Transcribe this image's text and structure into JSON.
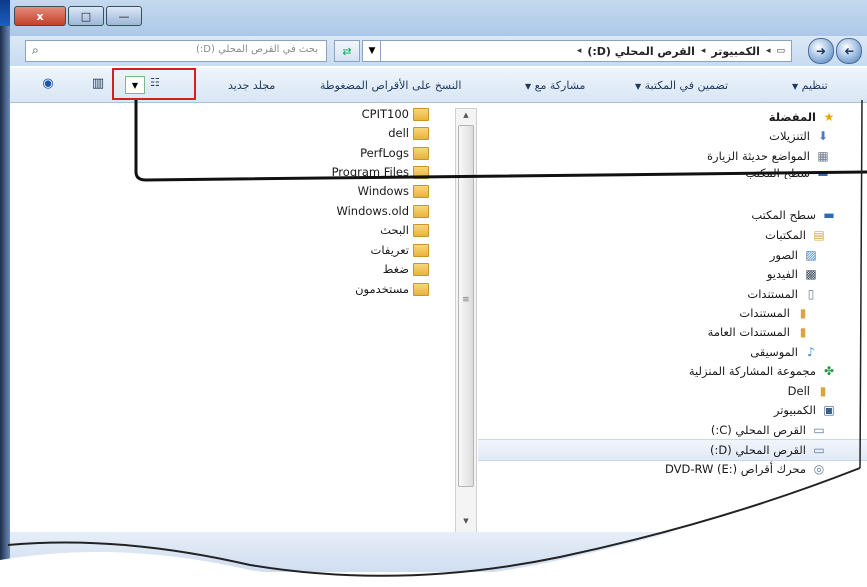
{
  "window": {
    "caption_buttons": [
      "x",
      "□",
      "—"
    ]
  },
  "address": {
    "search_placeholder": "بحث في القرص المحلي (D:)",
    "crumbs": [
      "الكمبيوتر",
      "القرص المحلي (D:)"
    ]
  },
  "toolbar": {
    "organize": "تنظيم",
    "include_library": "تضمين في المكتبة",
    "share_with": "مشاركة مع",
    "burn": "النسخ على الأقراص المضغوطة",
    "new_folder": "مجلد جديد"
  },
  "nav_tree": [
    {
      "label": "المفضلة",
      "icon": "star-icon",
      "bold": true
    },
    {
      "label": "التنزيلات",
      "icon": "downloads-icon",
      "bold": false
    },
    {
      "label": "المواضع حديثة الزيارة",
      "icon": "recent-places-icon",
      "bold": false
    },
    {
      "label": "سطح المكتب",
      "icon": "desktop-icon",
      "bold": false
    },
    {
      "label": "سطح المكتب",
      "icon": "desktop-icon",
      "bold": false
    },
    {
      "label": "المكتبات",
      "icon": "libraries-icon",
      "bold": false
    },
    {
      "label": "الصور",
      "icon": "pictures-icon",
      "bold": false
    },
    {
      "label": "الفيديو",
      "icon": "video-icon",
      "bold": false
    },
    {
      "label": "المستندات",
      "icon": "documents-icon",
      "bold": false
    },
    {
      "label": "المستندات",
      "icon": "documents-folder-icon",
      "bold": false
    },
    {
      "label": "المستندات العامة",
      "icon": "public-documents-icon",
      "bold": false
    },
    {
      "label": "الموسيقى",
      "icon": "music-icon",
      "bold": false
    },
    {
      "label": "مجموعة المشاركة المنزلية",
      "icon": "homegroup-icon",
      "bold": false
    },
    {
      "label": "Dell",
      "icon": "user-folder-icon",
      "bold": false
    },
    {
      "label": "الكمبيوتر",
      "icon": "computer-icon",
      "bold": false
    },
    {
      "label": "القرص المحلي (C:)",
      "icon": "drive-c-icon",
      "bold": false
    },
    {
      "label": "القرص المحلي (D:)",
      "icon": "drive-d-icon",
      "bold": false
    },
    {
      "label": "محرك أقراص DVD-RW (E:)",
      "icon": "dvd-drive-icon",
      "bold": false
    }
  ],
  "files": [
    "CPIT100",
    "dell",
    "PerfLogs",
    "Program Files",
    "Windows",
    "Windows.old",
    "البحث",
    "تعريفات",
    "ضغط",
    "مستخدمون"
  ]
}
